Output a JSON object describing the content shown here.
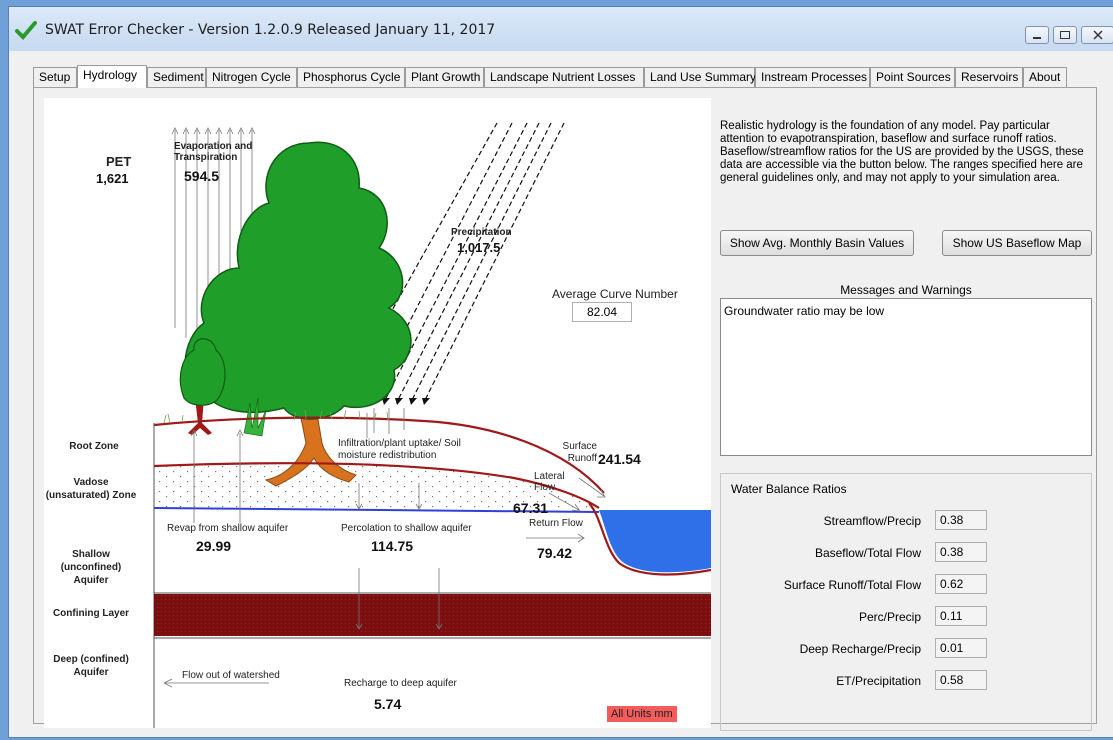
{
  "window": {
    "title": "SWAT Error Checker - Version 1.2.0.9 Released January 11, 2017"
  },
  "tabs": [
    {
      "label": "Setup"
    },
    {
      "label": "Hydrology"
    },
    {
      "label": "Sediment"
    },
    {
      "label": "Nitrogen Cycle"
    },
    {
      "label": "Phosphorus Cycle"
    },
    {
      "label": "Plant Growth"
    },
    {
      "label": "Landscape Nutrient Losses"
    },
    {
      "label": "Land Use Summary"
    },
    {
      "label": "Instream Processes"
    },
    {
      "label": "Point Sources"
    },
    {
      "label": "Reservoirs"
    },
    {
      "label": "About"
    }
  ],
  "diagram": {
    "pet_label": "PET",
    "pet_value": "1,621",
    "evap_label": "Evaporation and Transpiration",
    "evap_value": "594.5",
    "precip_label": "Precipitation",
    "precip_value": "1,017.5",
    "curve_label": "Average Curve Number",
    "curve_value": "82.04",
    "zones": {
      "root": "Root Zone",
      "vadose": "Vadose (unsaturated) Zone",
      "shallow": "Shallow (unconfined) Aquifer",
      "confining": "Confining Layer",
      "deep": "Deep (confined) Aquifer"
    },
    "infiltration_label": "Infiltration/plant uptake/ Soil moisture redistribution",
    "surface_runoff_label": "Surface Runoff",
    "surface_runoff_value": "241.54",
    "lateral_label": "Lateral Flow",
    "lateral_value": "67.31",
    "return_label": "Return Flow",
    "return_value": "79.42",
    "revap_label": "Revap from shallow aquifer",
    "revap_value": "29.99",
    "perc_label": "Percolation to shallow aquifer",
    "perc_value": "114.75",
    "outflow_label": "Flow out of watershed",
    "recharge_label": "Recharge to deep aquifer",
    "recharge_value": "5.74",
    "units_badge": "All Units mm"
  },
  "right": {
    "intro": "Realistic hydrology is the foundation of any model.  Pay particular attention to evapotranspiration, baseflow and surface runoff ratios. Baseflow/streamflow ratios for the US are provided by the USGS, these data are accessible via the button below.  The ranges specified here are general guidelines only, and may not apply to your simulation area.",
    "btn_monthly": "Show Avg. Monthly Basin Values",
    "btn_baseflow": "Show US Baseflow Map",
    "messages_title": "Messages and Warnings",
    "messages_text": "Groundwater ratio may be low",
    "wb_title": "Water Balance Ratios",
    "ratios": [
      {
        "label": "Streamflow/Precip",
        "value": "0.38"
      },
      {
        "label": "Baseflow/Total Flow",
        "value": "0.38"
      },
      {
        "label": "Surface Runoff/Total Flow",
        "value": "0.62"
      },
      {
        "label": "Perc/Precip",
        "value": "0.11"
      },
      {
        "label": "Deep Recharge/Precip",
        "value": "0.01"
      },
      {
        "label": "ET/Precipitation",
        "value": "0.58"
      }
    ]
  },
  "colors": {
    "soil_line": "#a01818",
    "water": "#2f6fe8",
    "confining": "#7a0f0f",
    "tree": "#1f9e2a",
    "trunk": "#d9721e",
    "badge": "#f25c5c"
  }
}
